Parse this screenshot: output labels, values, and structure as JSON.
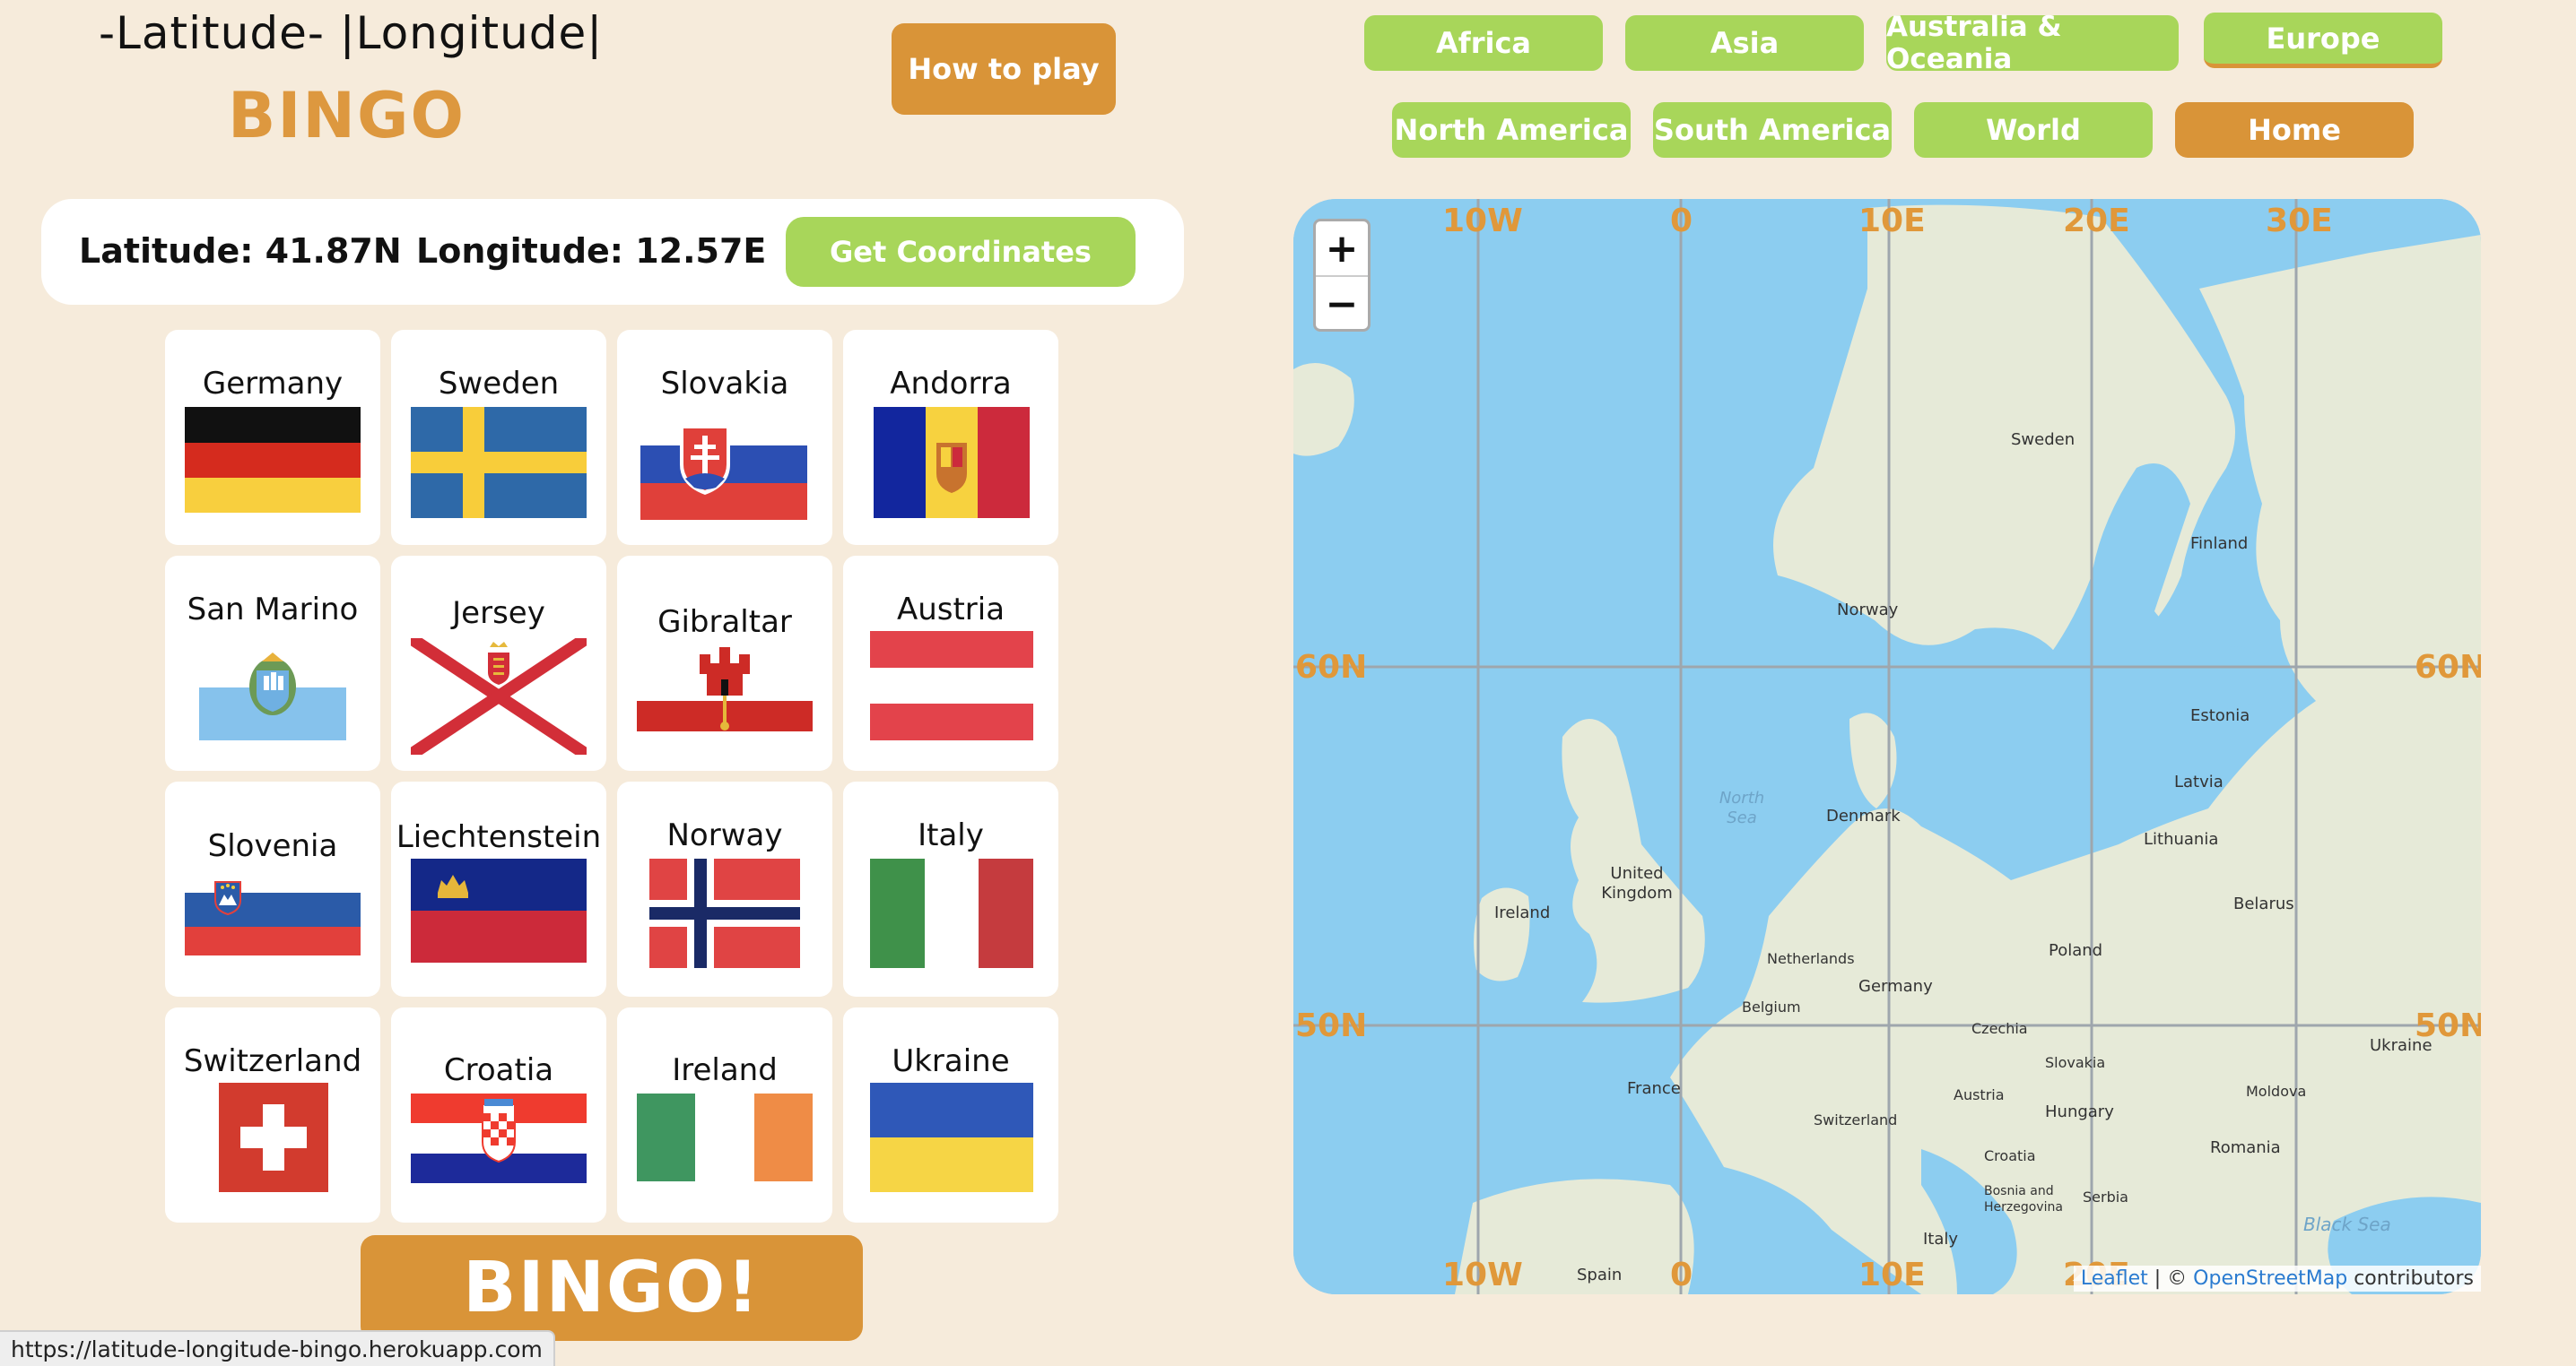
{
  "header": {
    "title_line1": "-Latitude- |Longitude|",
    "title_line2": "BINGO",
    "how_to_play": "How to play"
  },
  "regions": [
    {
      "label": "Africa"
    },
    {
      "label": "Asia"
    },
    {
      "label": "Australia & Oceania"
    },
    {
      "label": "Europe",
      "active": true
    },
    {
      "label": "North America"
    },
    {
      "label": "South America"
    },
    {
      "label": "World"
    }
  ],
  "home_label": "Home",
  "coordinates": {
    "latitude": "Latitude: 41.87N",
    "longitude": "Longitude: 12.57E",
    "button": "Get Coordinates"
  },
  "cards": [
    {
      "name": "Germany",
      "flag": "flag-germany"
    },
    {
      "name": "Sweden",
      "flag": "flag-sweden"
    },
    {
      "name": "Slovakia",
      "flag": "flag-slovakia"
    },
    {
      "name": "Andorra",
      "flag": "flag-andorra"
    },
    {
      "name": "San Marino",
      "flag": "flag-san-marino"
    },
    {
      "name": "Jersey",
      "flag": "flag-jersey"
    },
    {
      "name": "Gibraltar",
      "flag": "flag-gibraltar"
    },
    {
      "name": "Austria",
      "flag": "flag-austria"
    },
    {
      "name": "Slovenia",
      "flag": "flag-slovenia"
    },
    {
      "name": "Liechtenstein",
      "flag": "flag-liechtenstein"
    },
    {
      "name": "Norway",
      "flag": "flag-norway"
    },
    {
      "name": "Italy",
      "flag": "flag-italy"
    },
    {
      "name": "Switzerland",
      "flag": "flag-switzerland"
    },
    {
      "name": "Croatia",
      "flag": "flag-croatia"
    },
    {
      "name": "Ireland",
      "flag": "flag-ireland"
    },
    {
      "name": "Ukraine",
      "flag": "flag-ukraine"
    }
  ],
  "bingo_label": "BINGO!",
  "status_url": "https://latitude-longitude-bingo.herokuapp.com",
  "map": {
    "zoom_in": "+",
    "zoom_out": "−",
    "lon_labels_top": [
      "10W",
      "0",
      "10E",
      "20E",
      "30E"
    ],
    "lon_labels_bottom": [
      "10W",
      "0",
      "10E",
      "20E"
    ],
    "lat_labels": [
      "60N",
      "50N"
    ],
    "place_labels": [
      "Sweden",
      "Finland",
      "Norway",
      "Estonia",
      "Latvia",
      "Lithuania",
      "Denmark",
      "United Kingdom",
      "Ireland",
      "Netherlands",
      "Belgium",
      "Germany",
      "Poland",
      "Belarus",
      "Czechia",
      "Slovakia",
      "Austria",
      "Hungary",
      "Switzerland",
      "France",
      "Croatia",
      "Romania",
      "Moldova",
      "Ukraine",
      "Serbia",
      "Bosnia and Herzegovina",
      "Italy",
      "Spain",
      "North Sea",
      "Black Sea"
    ],
    "attribution_leaflet": "Leaflet",
    "attribution_sep": " | © ",
    "attribution_osm": "OpenStreetMap",
    "attribution_tail": " contributors"
  },
  "colors": {
    "background": "#f6ebdb",
    "accent_orange": "#d99438",
    "accent_green": "#a8d65a",
    "sea": "#8ccdf0",
    "land": "#e6ead8"
  }
}
